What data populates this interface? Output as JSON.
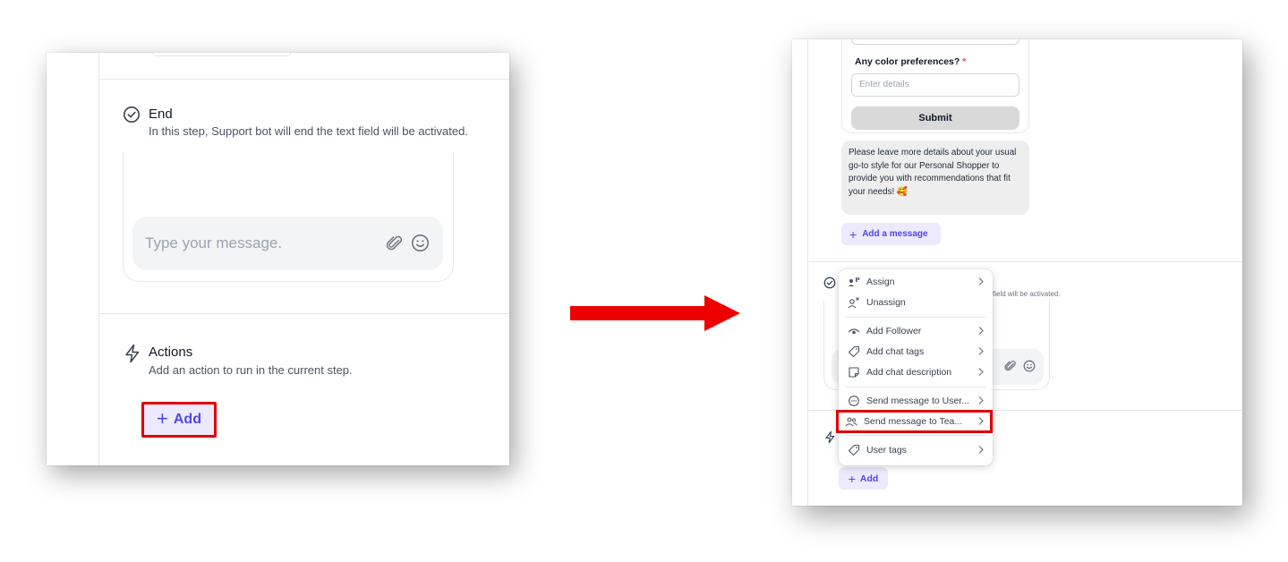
{
  "left_panel": {
    "end_step": {
      "title": "End",
      "description": "In this step, Support bot will end the text field will be activated."
    },
    "message_input": {
      "placeholder": "Type your message."
    },
    "actions": {
      "title": "Actions",
      "description": "Add an action to run in the current step.",
      "add_button": "Add"
    }
  },
  "right_panel": {
    "form": {
      "question": "Any color preferences?",
      "required_marker": "*",
      "field_placeholder": "Enter details",
      "submit_label": "Submit"
    },
    "bubble_text": "Please leave more details about your usual go-to style for our Personal Shopper to provide you with recommendations that fit your needs! 🥰",
    "add_message_label": "Add a message",
    "behind_sub": "field will be activated.",
    "add_button": "Add",
    "menu": [
      {
        "label": "Assign",
        "icon": "assign-icon",
        "submenu": true
      },
      {
        "label": "Unassign",
        "icon": "unassign-icon",
        "submenu": false
      },
      {
        "label": "Add Follower",
        "icon": "eye-icon",
        "submenu": true
      },
      {
        "label": "Add chat tags",
        "icon": "tag-icon",
        "submenu": true
      },
      {
        "label": "Add chat description",
        "icon": "note-icon",
        "submenu": true
      },
      {
        "label": "Send message to User...",
        "icon": "chat-bubble-icon",
        "submenu": true
      },
      {
        "label": "Send message to Tea...",
        "icon": "team-icon",
        "submenu": true,
        "highlighted": true
      },
      {
        "label": "User tags",
        "icon": "tag-icon",
        "submenu": true
      }
    ]
  },
  "colors": {
    "accent": "#4f46e5",
    "accent_bg": "#ede9fe",
    "highlight": "#e00000",
    "arrow": "#ee0000"
  }
}
